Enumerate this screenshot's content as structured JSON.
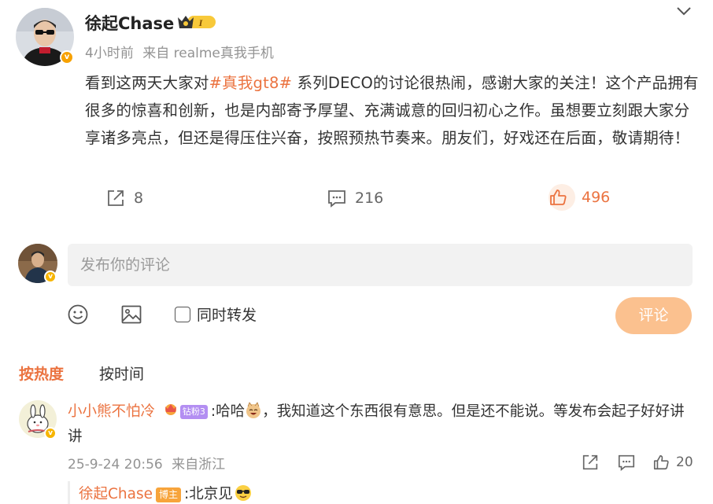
{
  "post": {
    "author": "徐起Chase",
    "crown_level": "I",
    "verified_mark": "v",
    "time": "4小时前",
    "source_prefix": "来自",
    "source": "realme真我手机",
    "text_before": "看到这两天大家对",
    "topic": "#真我gt8#",
    "text_after": " 系列DECO的讨论很热闹，感谢大家的关注！这个产品拥有很多的惊喜和创新，也是内部寄予厚望、充满诚意的回归初心之作。虽想要立刻跟大家分享诸多亮点，但还是得压住兴奋，按照预热节奏来。朋友们，好戏还在后面，敬请期待！",
    "reposts": "8",
    "comments": "216",
    "likes": "496"
  },
  "compose": {
    "placeholder": "发布你的评论",
    "repost_label": "同时转发",
    "submit_label": "评论"
  },
  "sort": {
    "hot": "按热度",
    "time": "按时间"
  },
  "comment": {
    "user": "小小熊不怕冷",
    "fan_badge": "钻粉3",
    "text_pre": ":哈哈",
    "text_post": "，我知道这个东西很有意思。但是还不能说。等发布会起子好好讲讲",
    "timestamp": "25-9-24 20:56",
    "location": "来自浙江",
    "likes": "20"
  },
  "reply": {
    "user": "徐起Chase",
    "badge": "博主",
    "text": ":北京见"
  },
  "colors": {
    "accent": "#eb7340",
    "submit_bg": "#fbc18f",
    "verified": "#f7a100"
  },
  "icons": [
    "chevron-down-icon",
    "repost-icon",
    "comment-icon",
    "like-icon",
    "emoji-icon",
    "image-icon",
    "laugh-cat-emoji",
    "sunglasses-emoji"
  ]
}
